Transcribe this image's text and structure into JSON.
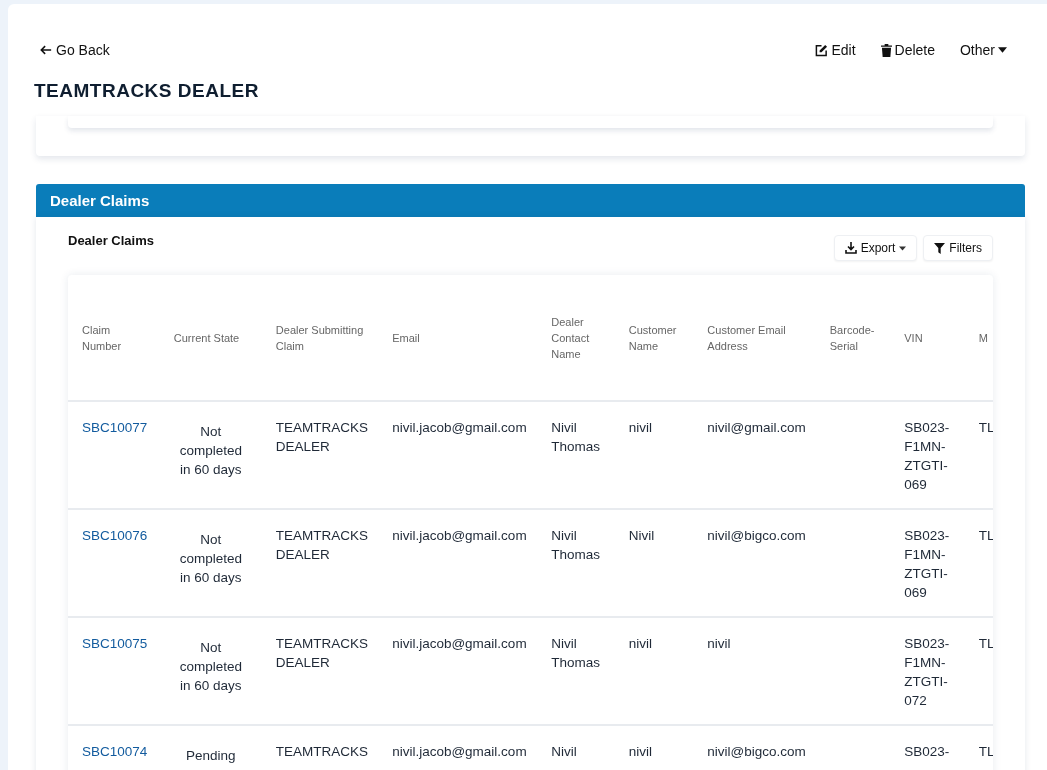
{
  "header": {
    "back": "Go Back",
    "title": "TEAMTRACKS DEALER",
    "actions": [
      {
        "kind": "edit",
        "label": "Edit"
      },
      {
        "kind": "delete",
        "label": "Delete"
      },
      {
        "kind": "other",
        "label": "Other"
      }
    ]
  },
  "panel": {
    "title": "Dealer Claims",
    "subtitle": "Dealer Claims",
    "export": "Export",
    "filters": "Filters"
  },
  "table": {
    "columns": [
      "Claim Number",
      "Current State",
      "Dealer Submitting Claim",
      "Email",
      "Dealer Contact Name",
      "Customer Name",
      "Customer Email Address",
      "Barcode-Serial",
      "VIN",
      "M"
    ],
    "rows": [
      {
        "claim": "SBC10077",
        "state": "Not completed in 60 days",
        "dealer": "TEAMTRACKS DEALER",
        "email": "nivil.jacob@gmail.com",
        "contact": "Nivil Thomas",
        "customer": "nivil",
        "customer_email": "nivil@gmail.com",
        "vin": "SB023-F1MN-ZTGTI-069",
        "column_10": "TL"
      },
      {
        "claim": "SBC10076",
        "state": "Not completed in 60 days",
        "dealer": "TEAMTRACKS DEALER",
        "email": "nivil.jacob@gmail.com",
        "contact": "Nivil Thomas",
        "customer": "Nivil",
        "customer_email": "nivil@bigco.com",
        "vin": "SB023-F1MN-ZTGTI-069",
        "column_10": "TL"
      },
      {
        "claim": "SBC10075",
        "state": "Not completed in 60 days",
        "dealer": "TEAMTRACKS DEALER",
        "email": "nivil.jacob@gmail.com",
        "contact": "Nivil Thomas",
        "customer": "nivil",
        "customer_email": "nivil",
        "vin": "SB023-F1MN-ZTGTI-072",
        "column_10": "TL"
      },
      {
        "claim": "SBC10074",
        "state": "Pending",
        "dealer": "TEAMTRACKS",
        "email": "nivil.jacob@gmail.com",
        "contact": "Nivil",
        "customer": "nivil",
        "customer_email": "nivil@bigco.com",
        "vin": "SB023-",
        "column_10": "TL"
      }
    ]
  }
}
